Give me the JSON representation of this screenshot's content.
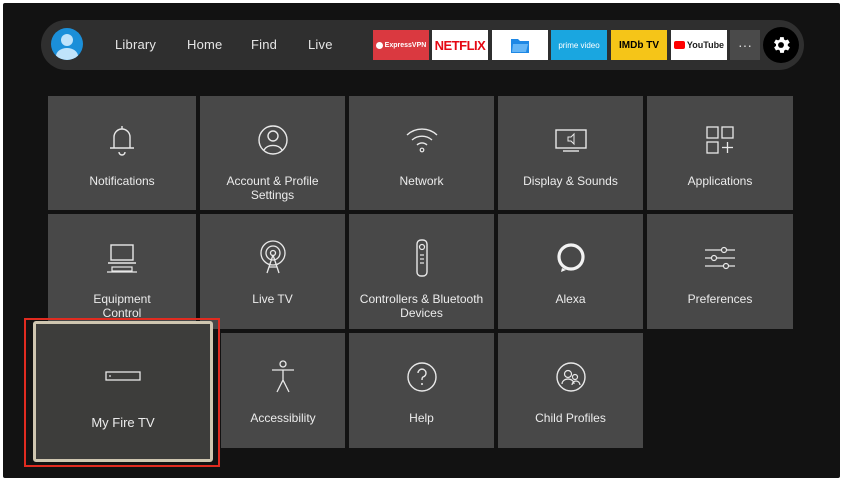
{
  "nav": {
    "items": [
      "Library",
      "Home",
      "Find",
      "Live"
    ]
  },
  "apps": [
    {
      "label": "ExpressVPN",
      "bg": "#da3940",
      "fg": "#ffffff"
    },
    {
      "label": "NETFLIX",
      "bg": "#ffffff",
      "fg": "#e50914"
    },
    {
      "label": "",
      "bg": "#ffffff",
      "fg": "#1e88e5"
    },
    {
      "label": "prime video",
      "bg": "#1aa6e0",
      "fg": "#ffffff"
    },
    {
      "label": "IMDb TV",
      "bg": "#f5c518",
      "fg": "#000000"
    },
    {
      "label": "YouTube",
      "bg": "#ffffff",
      "fg": "#212121"
    }
  ],
  "more_label": "···",
  "settings": {
    "tiles": [
      {
        "label": "Notifications",
        "icon": "bell-icon"
      },
      {
        "label": "Account & Profile Settings",
        "icon": "profile-icon"
      },
      {
        "label": "Network",
        "icon": "wifi-icon"
      },
      {
        "label": "Display & Sounds",
        "icon": "display-icon"
      },
      {
        "label": "Applications",
        "icon": "apps-grid-icon"
      },
      {
        "label": "Equipment Control",
        "icon": "tv-equipment-icon"
      },
      {
        "label": "Live TV",
        "icon": "antenna-icon"
      },
      {
        "label": "Controllers & Bluetooth Devices",
        "icon": "remote-icon"
      },
      {
        "label": "Alexa",
        "icon": "alexa-icon"
      },
      {
        "label": "Preferences",
        "icon": "sliders-icon"
      },
      {
        "label": "My Fire TV",
        "icon": "fire-tv-device-icon"
      },
      {
        "label": "Accessibility",
        "icon": "accessibility-icon"
      },
      {
        "label": "Help",
        "icon": "help-icon"
      },
      {
        "label": "Child Profiles",
        "icon": "child-profiles-icon"
      }
    ],
    "focused_tile": "My Fire TV"
  },
  "colors": {
    "highlight": "#e02b20",
    "tile_bg": "#484848",
    "screen_bg": "#121212",
    "focus_border": "#cfc6b0"
  }
}
